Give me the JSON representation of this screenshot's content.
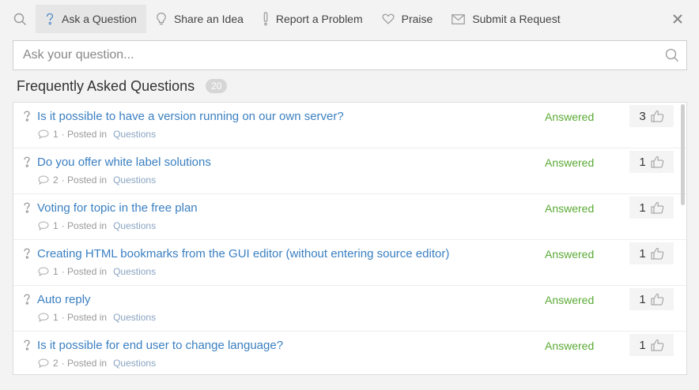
{
  "nav": {
    "tabs": [
      {
        "label": "Ask a Question",
        "icon": "question-icon",
        "active": true
      },
      {
        "label": "Share an Idea",
        "icon": "lightbulb-icon",
        "active": false
      },
      {
        "label": "Report a Problem",
        "icon": "exclamation-icon",
        "active": false
      },
      {
        "label": "Praise",
        "icon": "heart-icon",
        "active": false
      },
      {
        "label": "Submit a Request",
        "icon": "envelope-icon",
        "active": false
      }
    ]
  },
  "search": {
    "placeholder": "Ask your question..."
  },
  "faq": {
    "title": "Frequently Asked Questions",
    "count": "20"
  },
  "questions": [
    {
      "title": "Is it possible to have a version running on our own server?",
      "comments": "1",
      "posted_in": "· Posted in",
      "category": "Questions",
      "status": "Answered",
      "votes": "3"
    },
    {
      "title": "Do you offer white label solutions",
      "comments": "2",
      "posted_in": "· Posted in",
      "category": "Questions",
      "status": "Answered",
      "votes": "1"
    },
    {
      "title": "Voting for topic in the free plan",
      "comments": "1",
      "posted_in": "· Posted in",
      "category": "Questions",
      "status": "Answered",
      "votes": "1"
    },
    {
      "title": "Creating HTML bookmarks from the GUI editor (without entering source editor)",
      "comments": "1",
      "posted_in": "· Posted in",
      "category": "Questions",
      "status": "Answered",
      "votes": "1"
    },
    {
      "title": "Auto reply",
      "comments": "1",
      "posted_in": "· Posted in",
      "category": "Questions",
      "status": "Answered",
      "votes": "1"
    },
    {
      "title": "Is it possible for end user to change language?",
      "comments": "2",
      "posted_in": "· Posted in",
      "category": "Questions",
      "status": "Answered",
      "votes": "1"
    }
  ],
  "colors": {
    "link": "#3a7fc1",
    "answered": "#5aaa34",
    "active_tab": "#e6e6e6"
  }
}
